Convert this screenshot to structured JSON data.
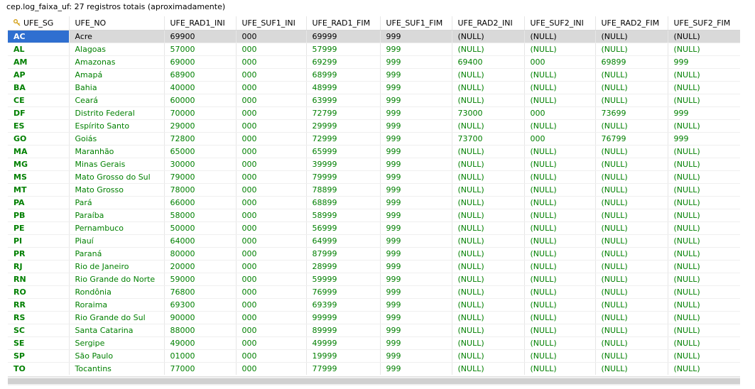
{
  "title": "cep.log_faixa_uf: 27 registros totais (aproximadamente)",
  "columns": [
    "UFE_SG",
    "UFE_NO",
    "UFE_RAD1_INI",
    "UFE_SUF1_INI",
    "UFE_RAD1_FIM",
    "UFE_SUF1_FIM",
    "UFE_RAD2_INI",
    "UFE_SUF2_INI",
    "UFE_RAD2_FIM",
    "UFE_SUF2_FIM"
  ],
  "key_icon": "key-icon",
  "colors": {
    "value": "#008000",
    "selected_row": "#d9d9d9",
    "selected_cell": "#2f6fd0"
  },
  "rows": [
    [
      "AC",
      "Acre",
      "69900",
      "000",
      "69999",
      "999",
      "(NULL)",
      "(NULL)",
      "(NULL)",
      "(NULL)"
    ],
    [
      "AL",
      "Alagoas",
      "57000",
      "000",
      "57999",
      "999",
      "(NULL)",
      "(NULL)",
      "(NULL)",
      "(NULL)"
    ],
    [
      "AM",
      "Amazonas",
      "69000",
      "000",
      "69299",
      "999",
      "69400",
      "000",
      "69899",
      "999"
    ],
    [
      "AP",
      "Amapá",
      "68900",
      "000",
      "68999",
      "999",
      "(NULL)",
      "(NULL)",
      "(NULL)",
      "(NULL)"
    ],
    [
      "BA",
      "Bahia",
      "40000",
      "000",
      "48999",
      "999",
      "(NULL)",
      "(NULL)",
      "(NULL)",
      "(NULL)"
    ],
    [
      "CE",
      "Ceará",
      "60000",
      "000",
      "63999",
      "999",
      "(NULL)",
      "(NULL)",
      "(NULL)",
      "(NULL)"
    ],
    [
      "DF",
      "Distrito Federal",
      "70000",
      "000",
      "72799",
      "999",
      "73000",
      "000",
      "73699",
      "999"
    ],
    [
      "ES",
      "Espírito Santo",
      "29000",
      "000",
      "29999",
      "999",
      "(NULL)",
      "(NULL)",
      "(NULL)",
      "(NULL)"
    ],
    [
      "GO",
      "Goiás",
      "72800",
      "000",
      "72999",
      "999",
      "73700",
      "000",
      "76799",
      "999"
    ],
    [
      "MA",
      "Maranhão",
      "65000",
      "000",
      "65999",
      "999",
      "(NULL)",
      "(NULL)",
      "(NULL)",
      "(NULL)"
    ],
    [
      "MG",
      "Minas Gerais",
      "30000",
      "000",
      "39999",
      "999",
      "(NULL)",
      "(NULL)",
      "(NULL)",
      "(NULL)"
    ],
    [
      "MS",
      "Mato Grosso do Sul",
      "79000",
      "000",
      "79999",
      "999",
      "(NULL)",
      "(NULL)",
      "(NULL)",
      "(NULL)"
    ],
    [
      "MT",
      "Mato Grosso",
      "78000",
      "000",
      "78899",
      "999",
      "(NULL)",
      "(NULL)",
      "(NULL)",
      "(NULL)"
    ],
    [
      "PA",
      "Pará",
      "66000",
      "000",
      "68899",
      "999",
      "(NULL)",
      "(NULL)",
      "(NULL)",
      "(NULL)"
    ],
    [
      "PB",
      "Paraíba",
      "58000",
      "000",
      "58999",
      "999",
      "(NULL)",
      "(NULL)",
      "(NULL)",
      "(NULL)"
    ],
    [
      "PE",
      "Pernambuco",
      "50000",
      "000",
      "56999",
      "999",
      "(NULL)",
      "(NULL)",
      "(NULL)",
      "(NULL)"
    ],
    [
      "PI",
      "Piauí",
      "64000",
      "000",
      "64999",
      "999",
      "(NULL)",
      "(NULL)",
      "(NULL)",
      "(NULL)"
    ],
    [
      "PR",
      "Paraná",
      "80000",
      "000",
      "87999",
      "999",
      "(NULL)",
      "(NULL)",
      "(NULL)",
      "(NULL)"
    ],
    [
      "RJ",
      "Rio de Janeiro",
      "20000",
      "000",
      "28999",
      "999",
      "(NULL)",
      "(NULL)",
      "(NULL)",
      "(NULL)"
    ],
    [
      "RN",
      "Rio Grande do Norte",
      "59000",
      "000",
      "59999",
      "999",
      "(NULL)",
      "(NULL)",
      "(NULL)",
      "(NULL)"
    ],
    [
      "RO",
      "Rondônia",
      "76800",
      "000",
      "76999",
      "999",
      "(NULL)",
      "(NULL)",
      "(NULL)",
      "(NULL)"
    ],
    [
      "RR",
      "Roraima",
      "69300",
      "000",
      "69399",
      "999",
      "(NULL)",
      "(NULL)",
      "(NULL)",
      "(NULL)"
    ],
    [
      "RS",
      "Rio Grande do Sul",
      "90000",
      "000",
      "99999",
      "999",
      "(NULL)",
      "(NULL)",
      "(NULL)",
      "(NULL)"
    ],
    [
      "SC",
      "Santa Catarina",
      "88000",
      "000",
      "89999",
      "999",
      "(NULL)",
      "(NULL)",
      "(NULL)",
      "(NULL)"
    ],
    [
      "SE",
      "Sergipe",
      "49000",
      "000",
      "49999",
      "999",
      "(NULL)",
      "(NULL)",
      "(NULL)",
      "(NULL)"
    ],
    [
      "SP",
      "São Paulo",
      "01000",
      "000",
      "19999",
      "999",
      "(NULL)",
      "(NULL)",
      "(NULL)",
      "(NULL)"
    ],
    [
      "TO",
      "Tocantins",
      "77000",
      "000",
      "77999",
      "999",
      "(NULL)",
      "(NULL)",
      "(NULL)",
      "(NULL)"
    ]
  ]
}
